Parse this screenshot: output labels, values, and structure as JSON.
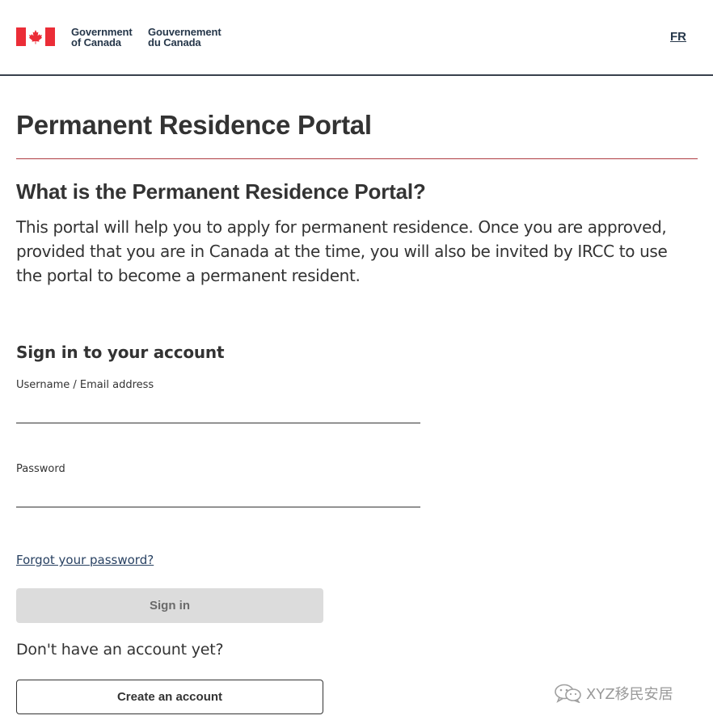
{
  "header": {
    "wordmark_en": [
      "Government",
      "of Canada"
    ],
    "wordmark_fr": [
      "Gouvernement",
      "du Canada"
    ],
    "language_link": "FR",
    "flag_icon": "canada-flag-icon",
    "flag_colors": {
      "red": "#eb2d37",
      "white": "#ffffff"
    }
  },
  "page": {
    "title": "Permanent Residence Portal",
    "rule_color": "#af3c43"
  },
  "about": {
    "heading": "What is the Permanent Residence Portal?",
    "body": "This portal will help you to apply for permanent residence. Once you are approved, provided that you are in Canada at the time, you will also be invited by IRCC to use the portal to become a permanent resident."
  },
  "signin": {
    "heading": "Sign in to your account",
    "username_label": "Username / Email address",
    "username_value": "",
    "password_label": "Password",
    "password_value": "",
    "forgot_link": "Forgot your password?",
    "signin_button": "Sign in",
    "signin_button_state": "disabled"
  },
  "register": {
    "prompt": "Don't have an account yet?",
    "create_button": "Create an account"
  },
  "watermark": {
    "text": "XYZ移民安居",
    "icon": "wechat-icon"
  }
}
